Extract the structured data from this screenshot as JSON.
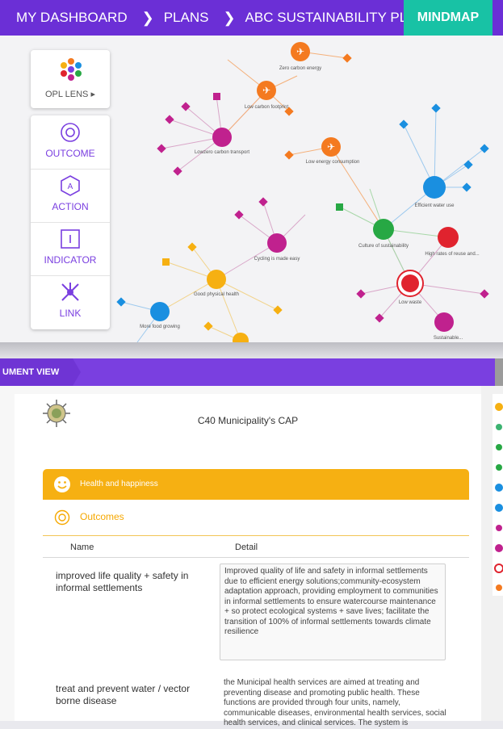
{
  "breadcrumb": {
    "home": "MY DASHBOARD",
    "plans": "PLANS",
    "plan": "ABC SUSTAINABILITY PLAN",
    "current": "MINDMAP",
    "separator": "❯"
  },
  "lens": {
    "label": "OPL LENS ▸"
  },
  "tools": [
    {
      "label": "OUTCOME"
    },
    {
      "label": "ACTION"
    },
    {
      "label": "INDICATOR"
    },
    {
      "label": "LINK"
    }
  ],
  "mindmap": {
    "nodes": {
      "zero_carbon": "Zero carbon energy",
      "low_carbon": "Low carbon footprint",
      "low_energy": "Low energy consumption",
      "lowzero_transport": "Lowzero carbon transport",
      "efficient_water": "Efficient water use",
      "culture": "Culture of sustainability",
      "high_reuse": "High rates of reuse and...",
      "low_waste": "Low waste",
      "cycling": "Cycling is made easy",
      "good_health": "Good physical health",
      "more_food": "More food growing",
      "sustainable": "Sustainable..."
    }
  },
  "document": {
    "tab": "UMENT VIEW",
    "title": "C40 Municipality's CAP",
    "theme": "Health and happiness",
    "section": "Outcomes",
    "columns": {
      "name": "Name",
      "detail": "Detail"
    },
    "rows": [
      {
        "name": "improved life quality + safety in informal settlements",
        "detail": "Improved quality of life and safety in informal settlements due to efficient energy solutions;community-ecosystem adaptation approach, providing employment to communities in informal settlements to ensure watercourse maintenance + so protect ecological systems + save lives; facilitate the transition of 100% of informal settlements towards climate resilience"
      },
      {
        "name": "treat and prevent water / vector borne disease",
        "detail": "the Municipal health services are aimed at treating and preventing disease and promoting public health. These functions are provided through four units, namely, communicable diseases, environmental health services, social health services, and clinical services. The system is"
      }
    ]
  },
  "colors": {
    "purple": "#7a3fe0",
    "teal": "#18c2a5",
    "orange": "#f47a20",
    "magenta": "#c0218e",
    "blue": "#1a8fe0",
    "green": "#27a844",
    "red": "#e0232e",
    "yellow": "#f6b012"
  }
}
